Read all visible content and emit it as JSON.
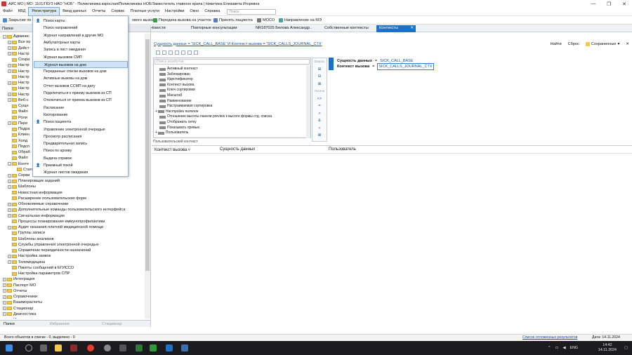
{
  "window": {
    "title": "АИС МО | МО: 1101/ГБУЗ НАО \"НОБ\" - Поликлиника взрослая/Поликлиника НОБ/Заместитель главного врача | Никитина Елизавета Игоревна",
    "controls": [
      "—",
      "❐",
      "✕"
    ]
  },
  "menubar": {
    "items": [
      "Файл",
      "КВД",
      "Регистратура",
      "Ввод данных",
      "Отчеты",
      "Сервис",
      "Платные услуги",
      "Настройки",
      "Окно",
      "Справка"
    ],
    "active": "Регистратура",
    "search_placeholder": "Поиск"
  },
  "toolbar": {
    "left": "Закрытие пе",
    "items": [
      "Передача вызова на участок",
      "Принять пациента",
      "МОСО",
      "Направление на МЭ"
    ],
    "partial": "ового вызова"
  },
  "tabs": {
    "items": [
      "Новости",
      "Повторные консультации",
      "NR187025 Белова Александр...",
      "Собственные контексты",
      "Контексты"
    ],
    "active_index": 4,
    "close": "✕"
  },
  "left_panel": {
    "header": "Папки",
    "tree_top": [
      {
        "label": "Админис",
        "level": 0,
        "expander": "-"
      },
      {
        "label": "Все по",
        "level": 1,
        "expander": "+"
      },
      {
        "label": "Дейст",
        "level": 1,
        "expander": "+"
      },
      {
        "label": "Настр",
        "level": 1,
        "expander": "+"
      },
      {
        "label": "Сохра",
        "level": 1,
        "expander": ""
      },
      {
        "label": "Настр",
        "level": 1,
        "expander": "+"
      },
      {
        "label": "Настр",
        "level": 1,
        "expander": "+"
      },
      {
        "label": "Настр",
        "level": 1,
        "expander": ""
      },
      {
        "label": "Настр",
        "level": 1,
        "expander": "+"
      },
      {
        "label": "Настр",
        "level": 1,
        "expander": ""
      },
      {
        "label": "Настр",
        "level": 1,
        "expander": "+"
      },
      {
        "label": "Веб-с",
        "level": 1,
        "expander": "+"
      },
      {
        "label": "Сущн",
        "level": 1,
        "expander": ""
      },
      {
        "label": "Файл",
        "level": 1,
        "expander": ""
      },
      {
        "label": "Роли",
        "level": 1,
        "expander": ""
      },
      {
        "label": "Пере",
        "level": 1,
        "expander": "+"
      },
      {
        "label": "Подра",
        "level": 1,
        "expander": ""
      },
      {
        "label": "Клиен",
        "level": 1,
        "expander": ""
      },
      {
        "label": "Холд",
        "level": 1,
        "expander": ""
      },
      {
        "label": "Подсп",
        "level": 1,
        "expander": ""
      },
      {
        "label": "Обраб",
        "level": 1,
        "expander": ""
      },
      {
        "label": "Файл",
        "level": 1,
        "expander": ""
      },
      {
        "label": "Конте",
        "level": 1,
        "expander": "-"
      },
      {
        "label": "Стати",
        "level": 2,
        "expander": ""
      },
      {
        "label": "Серви",
        "level": 1,
        "expander": "+"
      }
    ],
    "tree_bottom": [
      {
        "label": "Планировщик заданий",
        "level": 1,
        "expander": "+"
      },
      {
        "label": "Шаблоны",
        "level": 1,
        "expander": "+"
      },
      {
        "label": "Новостная информация",
        "level": 1,
        "expander": ""
      },
      {
        "label": "Расширение пользовательских форм",
        "level": 1,
        "expander": ""
      },
      {
        "label": "Обновляемые справочники",
        "level": 1,
        "expander": "+"
      },
      {
        "label": "Дополнительные команды пользовательского интерфейса",
        "level": 1,
        "expander": "+"
      },
      {
        "label": "Сигнальная информация",
        "level": 1,
        "expander": "+"
      },
      {
        "label": "Процессы планирования иммунопрофилактики",
        "level": 1,
        "expander": ""
      },
      {
        "label": "Аудит оказания платной медицинской помощи",
        "level": 1,
        "expander": "+"
      },
      {
        "label": "Группы записи",
        "level": 1,
        "expander": ""
      },
      {
        "label": "Шаблоны анализов",
        "level": 1,
        "expander": ""
      },
      {
        "label": "Службы управления электронной очередью",
        "level": 1,
        "expander": ""
      },
      {
        "label": "Справочник периодичности назначений",
        "level": 1,
        "expander": ""
      },
      {
        "label": "Настройка заявок",
        "level": 1,
        "expander": "+"
      },
      {
        "label": "Телемедицина",
        "level": 1,
        "expander": "+"
      },
      {
        "label": "Пакеты сообщений в ЕГИССО",
        "level": 1,
        "expander": ""
      },
      {
        "label": "Настройка параметров СПР",
        "level": 1,
        "expander": ""
      },
      {
        "label": "Интеграция",
        "level": 0,
        "expander": "+"
      },
      {
        "label": "Паспорт МО",
        "level": 0,
        "expander": "+"
      },
      {
        "label": "Отчеты",
        "level": 0,
        "expander": "+"
      },
      {
        "label": "Справочники",
        "level": 0,
        "expander": "+"
      },
      {
        "label": "Взаиморасчеты",
        "level": 0,
        "expander": "+"
      },
      {
        "label": "Стационар",
        "level": 0,
        "expander": "+"
      },
      {
        "label": "Диагностика",
        "level": 0,
        "expander": "+"
      },
      {
        "label": "Медицинские назначения",
        "level": 0,
        "expander": "+"
      }
    ],
    "footer_tabs": [
      "Папки",
      "Избранное",
      "Стационар"
    ]
  },
  "dropdown": {
    "items": [
      {
        "label": "Поиск карты",
        "icon": "person"
      },
      {
        "label": "Поиск направлений",
        "icon": ""
      },
      {
        "label": "Журнал направлений в другие МО",
        "icon": ""
      },
      {
        "label": "Амбулаторные карты",
        "icon": ""
      },
      {
        "label": "Запись в лист ожидания",
        "icon": ""
      },
      {
        "label": "Журнал вызовов СМП",
        "icon": ""
      },
      {
        "label": "Журнал вызовов на дом",
        "icon": "",
        "highlighted": true
      },
      {
        "label": "Переданные списки вызовов на дом",
        "icon": ""
      },
      {
        "label": "Активные вызовы на дом",
        "icon": ""
      },
      {
        "label": "Отчет вызовов ССМП на дату",
        "icon": ""
      },
      {
        "label": "Подключиться к приему вызовов из СП",
        "icon": ""
      },
      {
        "label": "Отключиться от приема вызовов из СП",
        "icon": ""
      },
      {
        "label": "Расписание",
        "icon": ""
      },
      {
        "label": "Квотирование",
        "icon": ""
      },
      {
        "label": "Поиск пациента",
        "icon": "person"
      },
      {
        "label": "Управление электронной очередью",
        "icon": ""
      },
      {
        "label": "Просмотр расписания",
        "icon": ""
      },
      {
        "label": "Предварительная запись",
        "icon": ""
      },
      {
        "label": "Поиск по архиву",
        "icon": ""
      },
      {
        "label": "Выдача справок",
        "icon": ""
      },
      {
        "label": "Приемный покой",
        "icon": "person"
      },
      {
        "label": "Журнал листов ожидания",
        "icon": ""
      }
    ]
  },
  "main": {
    "breadcrumb": "Сущность данных = 'SICK_CALL_BASE' И Контекст вызова = 'SICK_CALLS_JOURNAL_CTX'",
    "right_buttons": [
      "Найти",
      "Сброс",
      "Сохраненные"
    ],
    "field_search_placeholder": "Поиск атрибутов",
    "fields": [
      {
        "label": "Активный контекст",
        "indent": 0
      },
      {
        "label": "Заблокирован",
        "indent": 0
      },
      {
        "label": "Идентификатор",
        "indent": 0
      },
      {
        "label": "Контекст вызова",
        "indent": 0
      },
      {
        "label": "Ключ сортировки",
        "indent": 0
      },
      {
        "label": "Масштаб",
        "indent": 0
      },
      {
        "label": "Наименование",
        "indent": 0
      },
      {
        "label": "Настраиваемая сортировка",
        "indent": 0
      },
      {
        "label": "Настройки колонок",
        "indent": 0,
        "expander": "+",
        "italic": true
      },
      {
        "label": "Отношение высоты панели preview к высоте формы стд. списка",
        "indent": 0
      },
      {
        "label": "Отображать сетку",
        "indent": 0
      },
      {
        "label": "Показывать превью",
        "indent": 0
      },
      {
        "label": "Пользователь",
        "indent": 0,
        "expander": "+"
      }
    ],
    "ctx_label": "Пользовательский контекст",
    "operators": [
      {
        "label": "Запрос",
        "kind": "label"
      },
      {
        "label": "⊞",
        "kind": "op"
      },
      {
        "label": "⊟",
        "kind": "op"
      },
      {
        "label": "⊠",
        "kind": "op"
      },
      {
        "label": "Логичн",
        "kind": "label"
      },
      {
        "label": "<>",
        "kind": "op"
      },
      {
        "label": "=",
        "kind": "op"
      },
      {
        "label": ">",
        "kind": "op"
      },
      {
        "label": "&",
        "kind": "op"
      },
      {
        "label": "<",
        "kind": "op"
      },
      {
        "label": "⊠",
        "kind": "op"
      }
    ],
    "conditions": [
      {
        "field": "Сущность данных",
        "op": "=",
        "value": "SICK_CALL_BASE",
        "boxed": false
      },
      {
        "field": "Контекст вызова",
        "op": "=",
        "value": "SICK_CALLS_JOURNAL_CTX",
        "boxed": true
      }
    ],
    "grid_columns": [
      "Контекст вызова",
      "Сущность данных",
      "Пользователь"
    ]
  },
  "statusbar": {
    "left": "Всего объектов в списке - 0, выделено - 0",
    "link": "Список отложенных результатов",
    "date": "Дата: 14.11.2024"
  },
  "taskbar": {
    "lang": "ENG",
    "time": "14:42",
    "date": "14.11.2024"
  },
  "colors": {
    "accent": "#1e72c4",
    "link": "#1a4fa0",
    "folder": "#f2c94c",
    "highlight": "#cfe3f7"
  }
}
